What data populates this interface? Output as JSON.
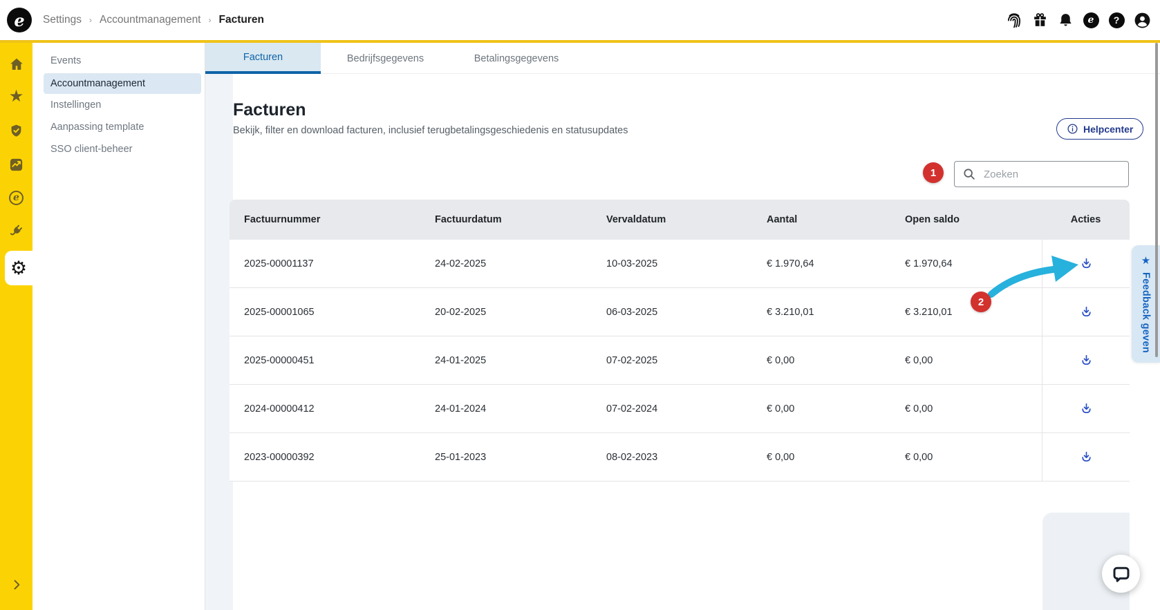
{
  "topbar": {
    "breadcrumb": {
      "items": [
        "Settings",
        "Accountmanagement",
        "Facturen"
      ],
      "separator": "›"
    },
    "logo_letter": "e",
    "icons": [
      "fingerprint-icon",
      "gift-icon",
      "bell-icon",
      "brand-e-icon",
      "help-icon",
      "account-icon"
    ],
    "help_glyph": "?"
  },
  "rail": {
    "items": [
      "home",
      "favorites",
      "security-shield",
      "statistics",
      "brand-e",
      "integrations-plug",
      "settings"
    ],
    "active_item": "settings",
    "gear_glyph": "⚙",
    "e_glyph": "e",
    "star_glyph": "★"
  },
  "sidebar": {
    "items": [
      {
        "label": "Events",
        "active": false
      },
      {
        "label": "Accountmanagement",
        "active": true
      },
      {
        "label": "Instellingen",
        "active": false
      },
      {
        "label": "Aanpassing template",
        "active": false
      },
      {
        "label": "SSO client-beheer",
        "active": false
      }
    ]
  },
  "tabs": [
    {
      "label": "Facturen",
      "active": true
    },
    {
      "label": "Bedrijfsgegevens",
      "active": false
    },
    {
      "label": "Betalingsgegevens",
      "active": false
    }
  ],
  "page": {
    "title": "Facturen",
    "subtitle": "Bekijk, filter en download facturen, inclusief terugbetalingsgeschiedenis en statusupdates",
    "helpcenter_label": "Helpcenter"
  },
  "search": {
    "placeholder": "Zoeken"
  },
  "table": {
    "columns": [
      "Factuurnummer",
      "Factuurdatum",
      "Vervaldatum",
      "Aantal",
      "Open saldo",
      "Acties"
    ],
    "rows": [
      {
        "cells": [
          "2025-00001137",
          "24-02-2025",
          "10-03-2025",
          "€ 1.970,64",
          "€ 1.970,64"
        ],
        "action": "download"
      },
      {
        "cells": [
          "2025-00001065",
          "20-02-2025",
          "06-03-2025",
          "€ 3.210,01",
          "€ 3.210,01"
        ],
        "action": "download"
      },
      {
        "cells": [
          "2025-00000451",
          "24-01-2025",
          "07-02-2025",
          "€ 0,00",
          "€ 0,00"
        ],
        "action": "download"
      },
      {
        "cells": [
          "2024-00000412",
          "24-01-2024",
          "07-02-2024",
          "€ 0,00",
          "€ 0,00"
        ],
        "action": "download"
      },
      {
        "cells": [
          "2023-00000392",
          "25-01-2023",
          "08-02-2023",
          "€ 0,00",
          "€ 0,00"
        ],
        "action": "download"
      }
    ]
  },
  "annotations": {
    "step1": "1",
    "step2": "2"
  },
  "feedback": {
    "label": "Feedback geven",
    "star_glyph": "★"
  },
  "colors": {
    "yellow": "#FBD304",
    "yellowLine": "#EFC319",
    "railIcon": "#6E5F26",
    "tabBlue": "#1063A7",
    "tabBg": "#D9E8F1",
    "navy": "#22398C",
    "downloadBlue": "#2A4FC7",
    "badgeRed": "#D2312E",
    "arrowCyan": "#27B1DD",
    "feedbackBg": "#D8E7F4",
    "feedbackBlue": "#1565C0",
    "activeItemBg": "#DBE8F3",
    "gutter": "#F0F4F8",
    "headerBg": "#E8E9EC",
    "divider": "#E4E4E7"
  }
}
